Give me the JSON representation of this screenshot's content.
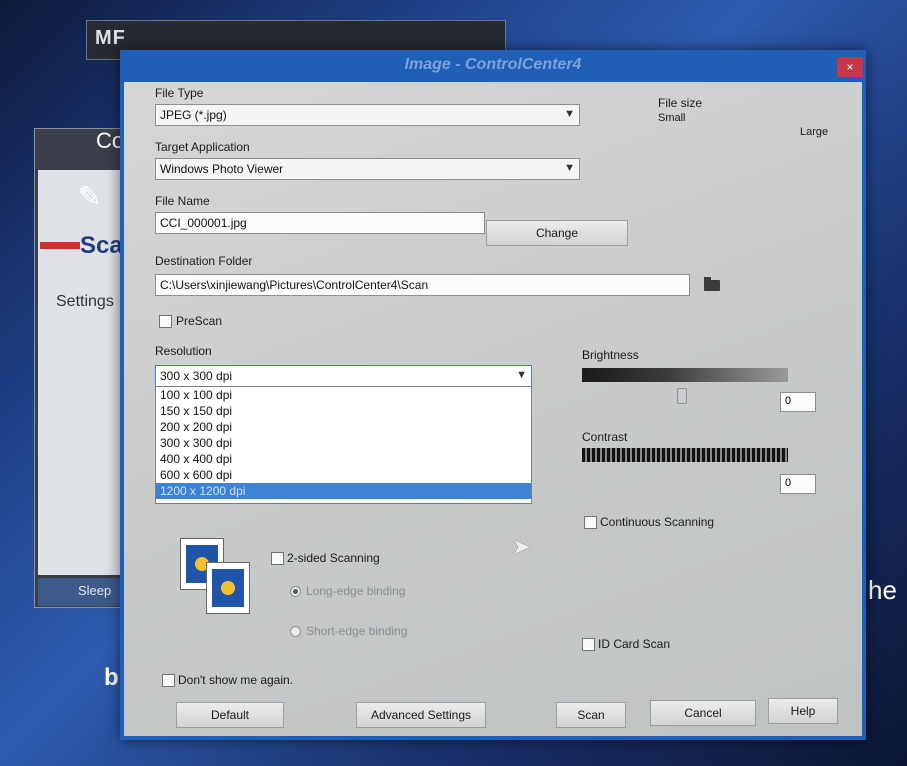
{
  "background": {
    "top_window_text": "MF",
    "app_title": "Co",
    "scan_label": "Sca",
    "settings_label": "Settings",
    "sleep_label": "Sleep",
    "bottom_char": "b",
    "right_edge_text": "he"
  },
  "dialog": {
    "title": "Image - ControlCenter4",
    "close_glyph": "×",
    "file_type": {
      "label": "File Type",
      "value": "JPEG (*.jpg)"
    },
    "file_size": {
      "label": "File size",
      "small": "Small",
      "large": "Large"
    },
    "target_application": {
      "label": "Target Application",
      "value": "Windows Photo Viewer"
    },
    "file_name": {
      "label": "File Name",
      "value": "CCI_000001.jpg"
    },
    "change_button": "Change",
    "destination_folder": {
      "label": "Destination Folder",
      "value": "C:\\Users\\xinjiewang\\Pictures\\ControlCenter4\\Scan"
    },
    "prescan": {
      "label": "PreScan",
      "checked": false
    },
    "resolution": {
      "label": "Resolution",
      "value": "300 x 300 dpi",
      "options": [
        "100 x 100 dpi",
        "150 x 150 dpi",
        "200 x 200 dpi",
        "300 x 300 dpi",
        "400 x 400 dpi",
        "600 x 600 dpi",
        "1200 x 1200 dpi"
      ],
      "highlighted_option": "1200 x 1200 dpi"
    },
    "brightness": {
      "label": "Brightness",
      "value": "0"
    },
    "contrast": {
      "label": "Contrast",
      "value": "0"
    },
    "continuous_scanning": {
      "label": "Continuous Scanning",
      "checked": false
    },
    "two_sided": {
      "label": "2-sided Scanning",
      "checked": false
    },
    "long_edge": {
      "label": "Long-edge binding",
      "selected": true
    },
    "short_edge": {
      "label": "Short-edge binding",
      "selected": false
    },
    "id_card_scan": {
      "label": "ID Card Scan",
      "checked": false
    },
    "dont_show": {
      "label": "Don't show me again.",
      "checked": false
    },
    "buttons": {
      "default": "Default",
      "advanced": "Advanced Settings",
      "scan": "Scan",
      "cancel": "Cancel",
      "help": "Help"
    }
  }
}
